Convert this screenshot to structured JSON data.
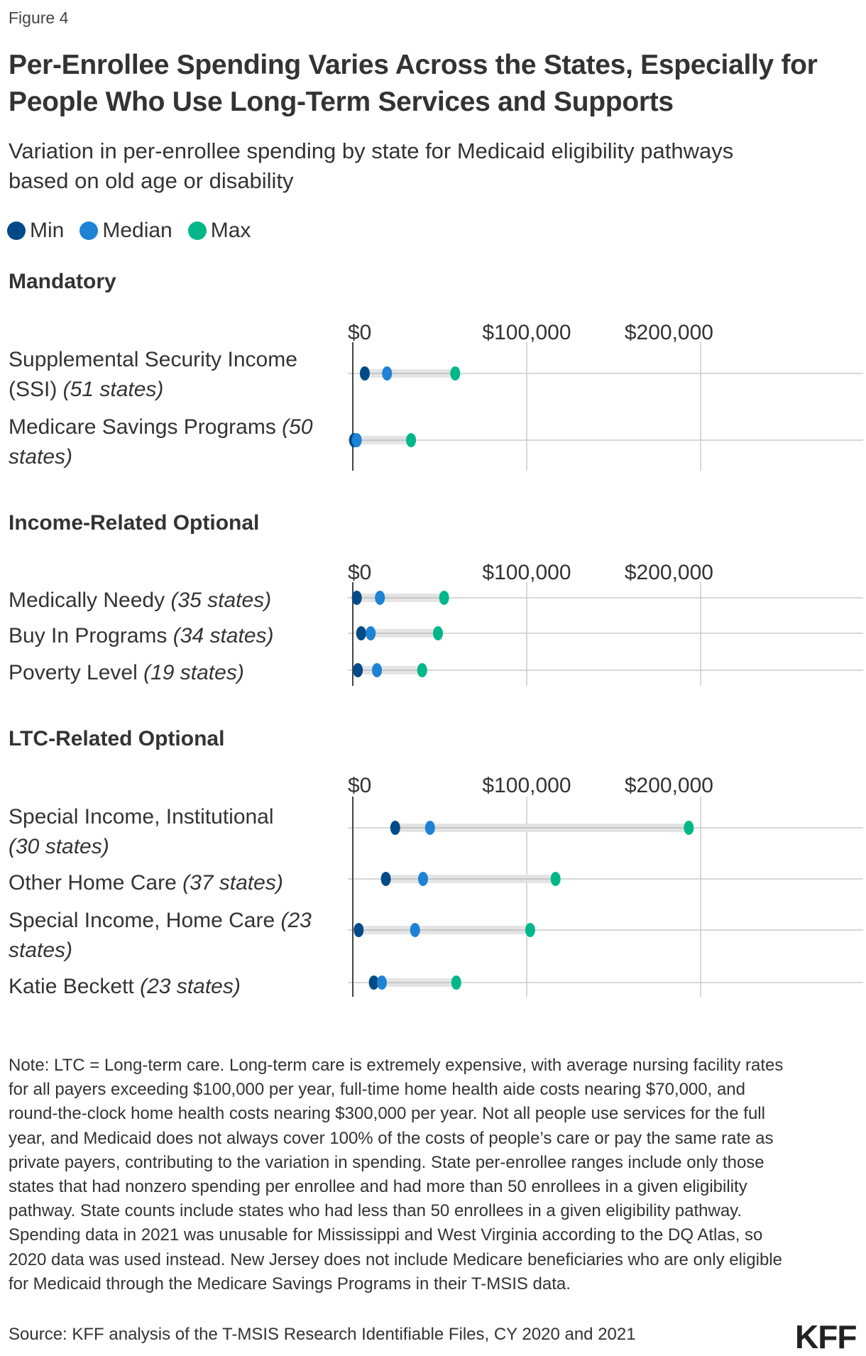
{
  "figure_label": "Figure 4",
  "title_lines": [
    "Per-Enrollee Spending Varies Across the States, Especially for",
    "People Who Use Long-Term Services and Supports"
  ],
  "subtitle_lines": [
    "Variation in per-enrollee spending by state for Medicaid eligibility pathways",
    "based on old age or disability"
  ],
  "legend": [
    {
      "label": "Min",
      "color": "#004b87"
    },
    {
      "label": "Median",
      "color": "#1e82d5"
    },
    {
      "label": "Max",
      "color": "#00b78a"
    }
  ],
  "colors": {
    "min": "#004b87",
    "median": "#1e82d5",
    "max": "#00b78a",
    "range_bar": "#e4e4e4",
    "gridline": "#cccccc",
    "axis": "#444444"
  },
  "chart_data": {
    "type": "dot-range",
    "title": "Per-Enrollee Spending Varies Across the States, Especially for People Who Use Long-Term Services and Supports",
    "subtitle": "Variation in per-enrollee spending by state for Medicaid eligibility pathways based on old age or disability",
    "xlabel": "",
    "ylabel": "",
    "xlim": [
      0,
      200000
    ],
    "ticks": [
      0,
      100000,
      200000
    ],
    "tick_labels": [
      "$0",
      "$100,000",
      "$200,000"
    ],
    "grid": true,
    "legend_position": "top-left",
    "series_names": [
      "Min",
      "Median",
      "Max"
    ],
    "panels": [
      {
        "name": "Mandatory",
        "rows": [
          {
            "label": "Supplemental Security Income (SSI)",
            "label_pre": "Supplemental Security Income",
            "label_line2": "(SSI)",
            "states": "(51 states)",
            "min": 6900,
            "median": 19700,
            "max": 58900
          },
          {
            "label": "Medicare Savings Programs",
            "label_pre": "Medicare Savings Programs",
            "states": "(50 states)",
            "min": 700,
            "median": 2300,
            "max": 33500
          }
        ]
      },
      {
        "name": "Income-Related Optional",
        "rows": [
          {
            "label": "Medically Needy",
            "label_pre": "Medically Needy",
            "states": "(35 states)",
            "min": 2300,
            "median": 15600,
            "max": 52500
          },
          {
            "label": "Buy In Programs",
            "label_pre": "Buy In Programs",
            "states": "(34 states)",
            "min": 4800,
            "median": 10300,
            "max": 49000
          },
          {
            "label": "Poverty Level",
            "label_pre": "Poverty Level",
            "states": "(19 states)",
            "min": 2900,
            "median": 13900,
            "max": 39900
          }
        ]
      },
      {
        "name": "LTC-Related Optional",
        "rows": [
          {
            "label": "Special Income, Institutional",
            "label_pre": "Special Income, Institutional",
            "states": "(30 states)",
            "min": 24400,
            "median": 44400,
            "max": 193200
          },
          {
            "label": "Other Home Care",
            "label_pre": "Other Home Care",
            "states": "(37 states)",
            "min": 19000,
            "median": 40400,
            "max": 116600
          },
          {
            "label": "Special Income, Home Care",
            "label_pre": "Special Income, Home Care",
            "states": "(23 states)",
            "min": 3400,
            "median": 35800,
            "max": 102000
          },
          {
            "label": "Katie Beckett",
            "label_pre": "Katie Beckett",
            "states": "(23 states)",
            "min": 12100,
            "median": 16700,
            "max": 59500
          }
        ]
      }
    ]
  },
  "sections": [
    {
      "title": "Mandatory"
    },
    {
      "title": "Income-Related Optional"
    },
    {
      "title": "LTC-Related Optional"
    }
  ],
  "row_labels": {
    "ssi_l1": "Supplemental Security Income",
    "ssi_l2": "(SSI) ",
    "ssi_states": "(51 states)",
    "msp_l1": "Medicare Savings Programs ",
    "msp_states_a": "(50",
    "msp_states_b": "states)",
    "mn": "Medically Needy ",
    "mn_states": "(35 states)",
    "bi": "Buy In Programs ",
    "bi_states": "(34 states)",
    "pl": "Poverty Level ",
    "pl_states": "(19 states)",
    "sii_l1": "Special Income, Institutional",
    "sii_states": "(30 states)",
    "ohc": "Other Home Care ",
    "ohc_states": "(37 states)",
    "sihc_l1": "Special Income, Home Care ",
    "sihc_states_a": "(23",
    "sihc_states_b": "states)",
    "kb": "Katie Beckett ",
    "kb_states": "(23 states)"
  },
  "note": "Note: LTC = Long-term care. Long-term care is extremely expensive, with average nursing facility rates for all payers exceeding $100,000 per year, full-time home health aide costs nearing $70,000, and round-the-clock home health costs nearing $300,000 per year. Not all people use services for the full year, and Medicaid does not always cover 100% of the costs of people’s care or pay the same rate as private payers, contributing to the variation in spending. State per-enrollee ranges include only those states that had nonzero spending per enrollee and had more than 50 enrollees in a given eligibility pathway. State counts include states who had less than 50 enrollees in a given eligibility pathway. Spending data in 2021 was unusable for Mississippi and West Virginia according to the DQ Atlas, so 2020 data was used instead. New Jersey does not include Medicare beneficiaries who are only eligible for Medicaid through the Medicare Savings Programs in their T-MSIS data.",
  "source": "Source: KFF analysis of the T-MSIS Research Identifiable Files, CY 2020 and 2021",
  "logo": "KFF"
}
